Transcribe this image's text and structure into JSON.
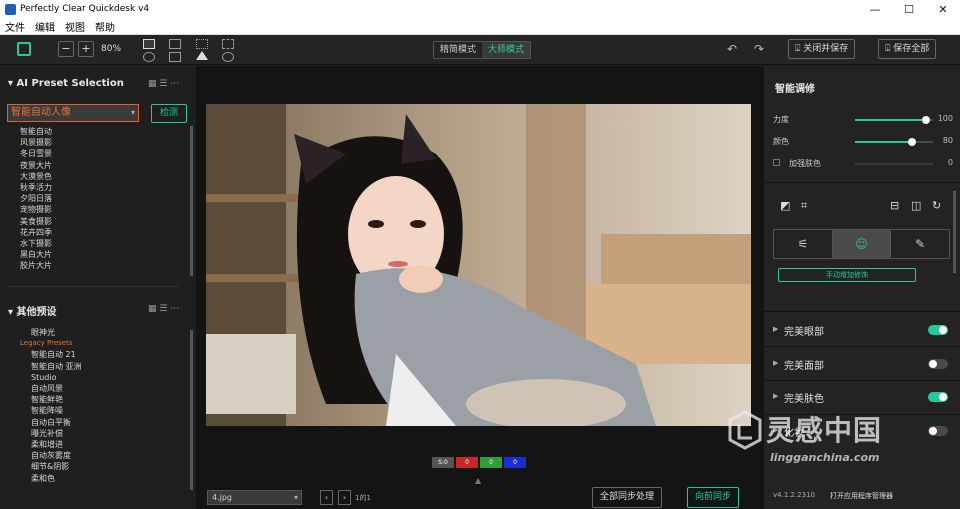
{
  "window": {
    "title": "Perfectly Clear Quickdesk v4",
    "controls": {
      "minimize": "—",
      "maximize": "☐",
      "close": "✕"
    }
  },
  "menu": {
    "items": [
      "文件",
      "编辑",
      "视图",
      "帮助"
    ]
  },
  "toolbar": {
    "zoom_minus": "−",
    "zoom_plus": "+",
    "zoom_value": "80%",
    "modes": [
      "精简模式",
      "大师模式"
    ],
    "active_mode": "大师模式",
    "undo": "↶",
    "redo": "↷",
    "close_save": "关闭并保存",
    "save_all": "保存全部",
    "close_save_icon": "⍗",
    "save_all_icon": "⍗"
  },
  "left": {
    "ai_title": "AI Preset Selection",
    "preset_selected": "智能自动人像",
    "detect_label": "检测",
    "ai_presets": [
      "智能自动",
      "风景摄影",
      "冬日雪景",
      "夜景大片",
      "大漠景色",
      "秋季活力",
      "夕阳日落",
      "宠物摄影",
      "美食摄影",
      "花卉四季",
      "水下摄影",
      "黑白大片",
      "胶片大片"
    ],
    "other_title": "其他预设",
    "other_presets": [
      {
        "label": "眼神光",
        "style": "indent"
      },
      {
        "label": "Legacy Presets",
        "style": "orange"
      },
      {
        "label": "智能自动 21",
        "style": "indent"
      },
      {
        "label": "智能自动 亚洲",
        "style": "indent"
      },
      {
        "label": "Studio",
        "style": "indent"
      },
      {
        "label": "自动风景",
        "style": "indent"
      },
      {
        "label": "智能鲜艳",
        "style": "indent"
      },
      {
        "label": "智能降噪",
        "style": "indent"
      },
      {
        "label": "自动白平衡",
        "style": "indent"
      },
      {
        "label": "曝光补偿",
        "style": "indent"
      },
      {
        "label": "柔和增进",
        "style": "indent"
      },
      {
        "label": "自动灰雾度",
        "style": "indent"
      },
      {
        "label": "细节&阴影",
        "style": "indent"
      },
      {
        "label": "柔和色",
        "style": "indent"
      }
    ],
    "view_icons": "▦ ☰ ⋯"
  },
  "center": {
    "color_boxes": [
      {
        "label": "S:0",
        "color": "#555555"
      },
      {
        "label": "0",
        "color": "#c62828"
      },
      {
        "label": "0",
        "color": "#2e9d3a"
      },
      {
        "label": "0",
        "color": "#1a2fd0"
      }
    ],
    "file_name": "4.jpg",
    "prev": "‹",
    "next": "›",
    "page_count": "1的1",
    "sync_all": "全部同步处理",
    "sync_forward": "向前同步"
  },
  "right": {
    "title": "智能调修",
    "sliders": [
      {
        "label": "力度",
        "value": 100,
        "display": "100"
      },
      {
        "label": "颜色",
        "value": 80,
        "display": "80"
      }
    ],
    "enhance_skin": {
      "label": "加强肤色",
      "value": "0"
    },
    "manual_label": "手动增加修饰",
    "features": [
      {
        "label": "完美眼部",
        "on": true
      },
      {
        "label": "完美面部",
        "on": false
      },
      {
        "label": "完美肤色",
        "on": true
      },
      {
        "label": "化妆",
        "on": false
      }
    ],
    "version": "v4.1.2.2310",
    "open_manager": "打开应用程序管理器"
  },
  "watermark": {
    "text": "灵感中国",
    "url": "lingganchina.com"
  },
  "colors": {
    "accent": "#27c7a0",
    "preset_orange": "#e8703a"
  }
}
